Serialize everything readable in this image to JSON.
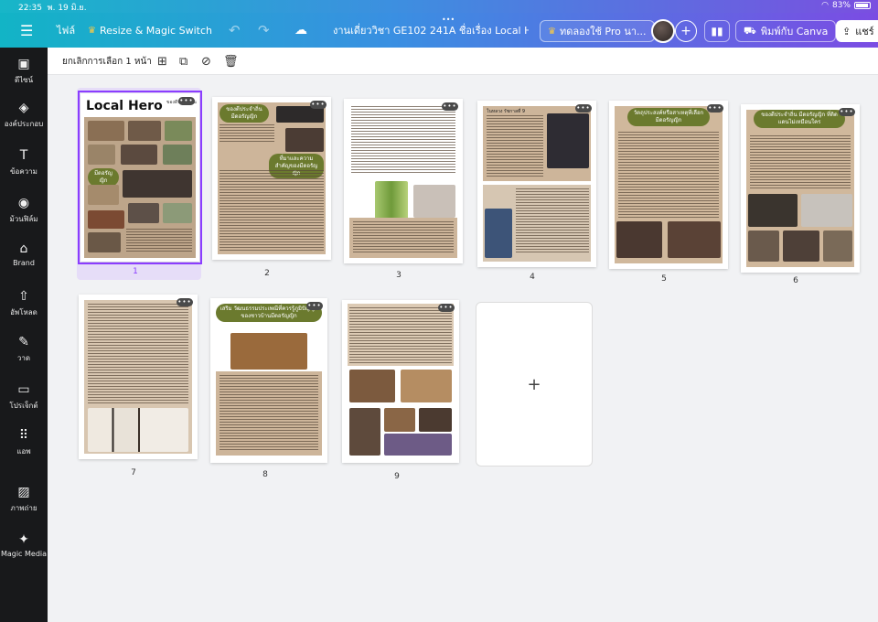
{
  "status": {
    "time": "22:35",
    "date": "พ. 19 มิ.ย.",
    "battery": "83%"
  },
  "header": {
    "file": "ไฟล์",
    "resize": "Resize & Magic Switch",
    "doc_title": "งานเดี่ยววิชา GE102 241A ชื่อเรื่อง Local Hero ...",
    "trial": "ทดลองใช้ Pro นา...",
    "print": "พิมพ์กับ Canva",
    "share": "แชร์"
  },
  "sidebar": {
    "items": [
      {
        "label": "ดีไซน์",
        "icon": "layout-icon"
      },
      {
        "label": "องค์ประกอบ",
        "icon": "elements-icon"
      },
      {
        "label": "ข้อความ",
        "icon": "text-icon"
      },
      {
        "label": "ม้วนฟิล์ม",
        "icon": "camera-icon"
      },
      {
        "label": "Brand",
        "icon": "brand-icon"
      },
      {
        "label": "อัพโหลด",
        "icon": "upload-icon"
      },
      {
        "label": "วาด",
        "icon": "draw-icon"
      },
      {
        "label": "โปรเจ็กต์",
        "icon": "folder-icon"
      },
      {
        "label": "แอพ",
        "icon": "apps-icon"
      },
      {
        "label": "ภาพถ่าย",
        "icon": "photo-icon"
      },
      {
        "label": "Magic Media",
        "icon": "magic-media-icon"
      }
    ]
  },
  "toolbar": {
    "deselect": "ยกเลิกการเลือก 1 หน้า"
  },
  "pages": [
    {
      "num": "1",
      "title": "Local Hero",
      "sub": "ของดีประจำถิ่น",
      "badge": "มีดอรัญญิก"
    },
    {
      "num": "2",
      "pill1": "ของดีประจำถิ่น มีดอรัญญิก",
      "pill2": "ที่มาและความสำคัญของมีดอรัญญิก"
    },
    {
      "num": "3",
      "pill1": "กระบวนการผลิต"
    },
    {
      "num": "4",
      "pill1": "ในหลวง รัชกาลที่ 9"
    },
    {
      "num": "5",
      "pill1": "วัตถุประสงค์หรือสาเหตุที่เลือกมีดอรัญญิก"
    },
    {
      "num": "6",
      "pill1": "ของดีประจำถิ่น มีดอรัญญิก ที่ติดแดนไม่เหมือนใคร"
    },
    {
      "num": "7"
    },
    {
      "num": "8",
      "pill1": "เสริม วัฒนธรรมประเพณีที่ควรรู้ภูมิปัญญาของชาวบ้านมีดอรัญญิก"
    },
    {
      "num": "9"
    }
  ],
  "add_page": "+"
}
